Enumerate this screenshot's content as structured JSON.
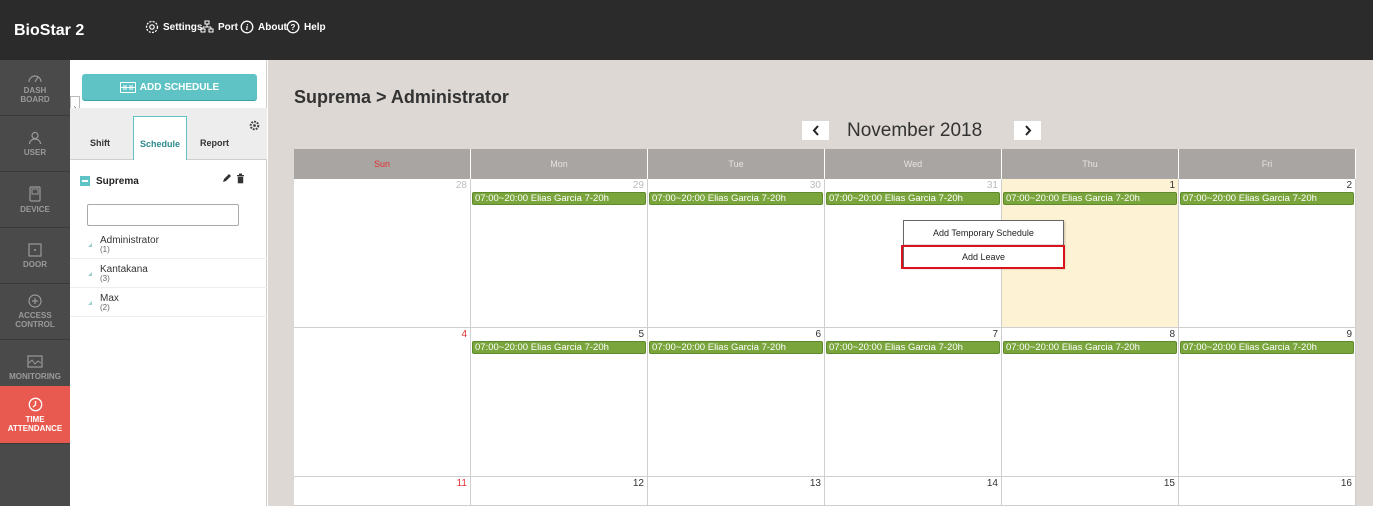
{
  "topbar": {
    "brand": "BioStar 2",
    "settings": "Settings",
    "port": "Port",
    "about": "About",
    "help": "Help"
  },
  "rail": [
    {
      "label": "DASH BOARD",
      "line1": "DASH",
      "line2": "BOARD",
      "icon": "gauge-icon"
    },
    {
      "label": "USER",
      "line1": "USER",
      "line2": "",
      "icon": "user-icon"
    },
    {
      "label": "DEVICE",
      "line1": "DEVICE",
      "line2": "",
      "icon": "device-icon"
    },
    {
      "label": "DOOR",
      "line1": "DOOR",
      "line2": "",
      "icon": "door-icon"
    },
    {
      "label": "ACCESS CONTROL",
      "line1": "ACCESS",
      "line2": "CONTROL",
      "icon": "plus-circle-icon"
    },
    {
      "label": "MONITORING",
      "line1": "MONITORING",
      "line2": "",
      "icon": "monitor-icon"
    },
    {
      "label": "TIME ATTENDANCE",
      "line1": "TIME",
      "line2": "ATTENDANCE",
      "icon": "clock-icon",
      "active": true
    }
  ],
  "panel": {
    "add_button": "ADD SCHEDULE",
    "tabs": [
      "Shift",
      "Schedule",
      "Report"
    ],
    "active_tab": "Schedule",
    "group": "Suprema",
    "search_value": "",
    "tree": [
      {
        "name": "Administrator",
        "count": "(1)"
      },
      {
        "name": "Kantakana",
        "count": "(3)"
      },
      {
        "name": "Max",
        "count": "(2)"
      }
    ]
  },
  "main": {
    "title": "Suprema > Administrator",
    "month": "November 2018",
    "weekdays": [
      "Sun",
      "Mon",
      "Tue",
      "Wed",
      "Thu",
      "Fri"
    ],
    "weeks": [
      {
        "days": [
          {
            "num": "28",
            "other": true,
            "event": ""
          },
          {
            "num": "29",
            "other": true,
            "event": "07:00~20:00 Elias Garcia 7-20h"
          },
          {
            "num": "30",
            "other": true,
            "event": "07:00~20:00 Elias Garcia 7-20h"
          },
          {
            "num": "31",
            "other": true,
            "event": "07:00~20:00 Elias Garcia 7-20h"
          },
          {
            "num": "1",
            "other": false,
            "today": true,
            "event": "07:00~20:00 Elias Garcia 7-20h"
          },
          {
            "num": "2",
            "other": false,
            "event": "07:00~20:00 Elias Garcia 7-20h"
          }
        ]
      },
      {
        "days": [
          {
            "num": "4",
            "other": false,
            "sun": true,
            "event": ""
          },
          {
            "num": "5",
            "other": false,
            "event": "07:00~20:00 Elias Garcia 7-20h"
          },
          {
            "num": "6",
            "other": false,
            "event": "07:00~20:00 Elias Garcia 7-20h"
          },
          {
            "num": "7",
            "other": false,
            "event": "07:00~20:00 Elias Garcia 7-20h"
          },
          {
            "num": "8",
            "other": false,
            "event": "07:00~20:00 Elias Garcia 7-20h"
          },
          {
            "num": "9",
            "other": false,
            "event": "07:00~20:00 Elias Garcia 7-20h"
          }
        ]
      },
      {
        "days": [
          {
            "num": "11",
            "other": false,
            "sun": true,
            "event": ""
          },
          {
            "num": "12",
            "other": false,
            "event": ""
          },
          {
            "num": "13",
            "other": false,
            "event": ""
          },
          {
            "num": "14",
            "other": false,
            "event": ""
          },
          {
            "num": "15",
            "other": false,
            "event": ""
          },
          {
            "num": "16",
            "other": false,
            "event": ""
          }
        ]
      }
    ]
  },
  "context_menu": {
    "items": [
      "Add Temporary Schedule",
      "Add Leave"
    ],
    "highlighted": "Add Leave"
  },
  "colors": {
    "topbar": "#2b2b2b",
    "accent": "#5fc3c6",
    "active_rail": "#e85a4f",
    "event": "#7aa53d",
    "highlight": "#d9121b"
  }
}
